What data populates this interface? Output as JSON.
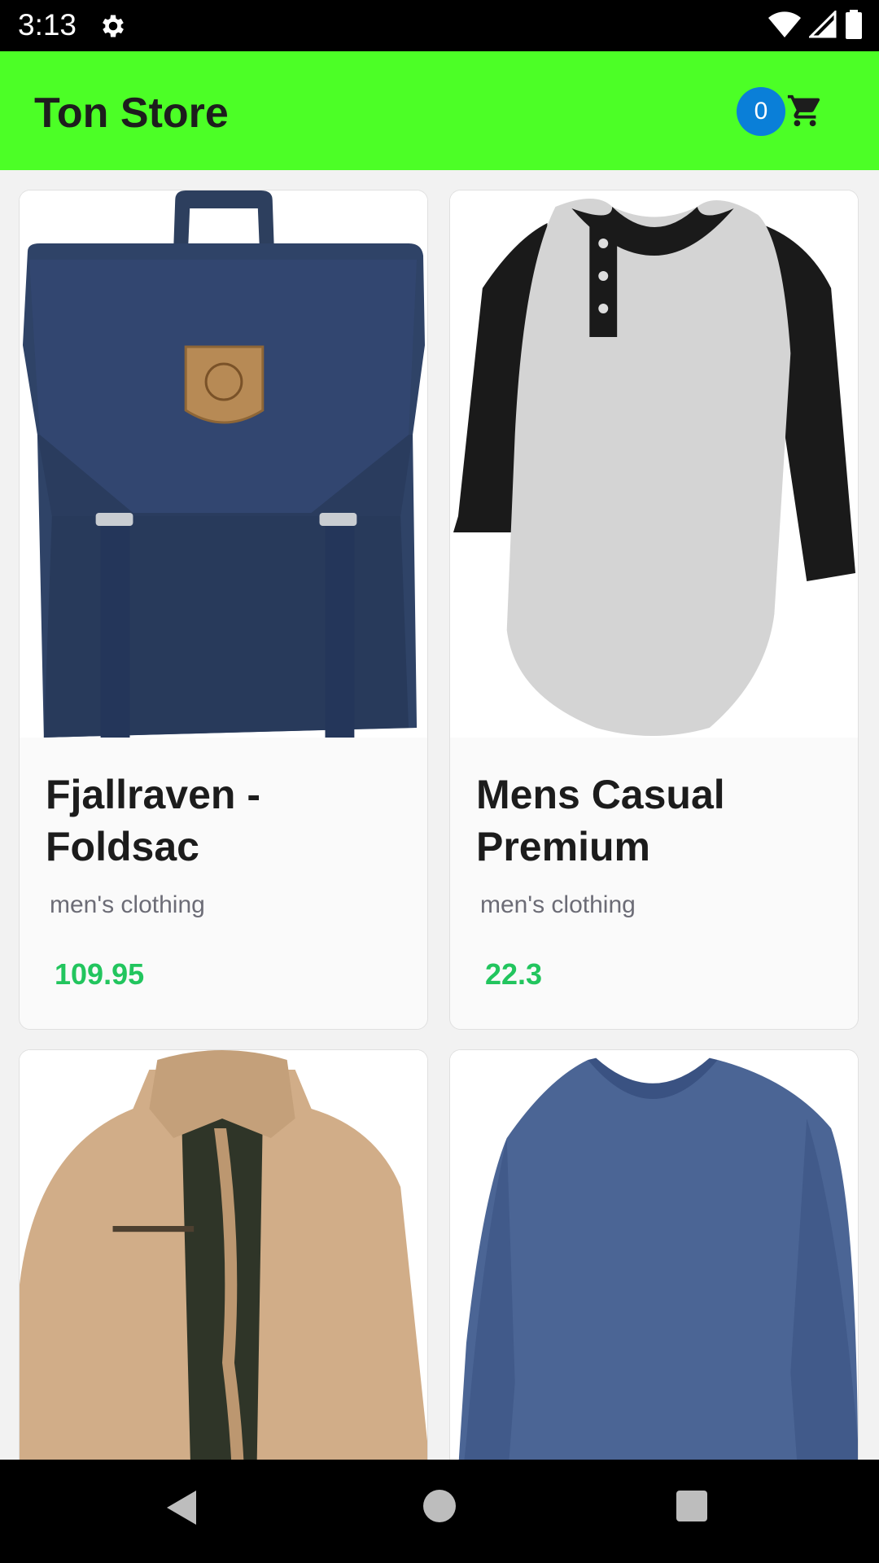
{
  "status_bar": {
    "time": "3:13",
    "icons": [
      "settings-gear-icon",
      "wifi-icon",
      "signal-icon",
      "battery-icon"
    ]
  },
  "app_bar": {
    "title": "Ton Store",
    "cart_count": "0",
    "cart_icon": "shopping-cart-icon",
    "background": "#4cff26",
    "badge_color": "#0a7fd8"
  },
  "products": [
    {
      "title": "Fjallraven - Foldsac",
      "category": "men's clothing",
      "price": "109.95",
      "image": "navy-backpack"
    },
    {
      "title": "Mens Casual Premium",
      "category": "men's clothing",
      "price": "22.3",
      "image": "raglan-henley-shirt"
    },
    {
      "image": "khaki-jacket"
    },
    {
      "image": "blue-long-sleeve-shirt"
    }
  ],
  "price_color": "#22c55e",
  "nav_bar": {
    "icons": [
      "back-icon",
      "home-icon",
      "recents-icon"
    ]
  }
}
